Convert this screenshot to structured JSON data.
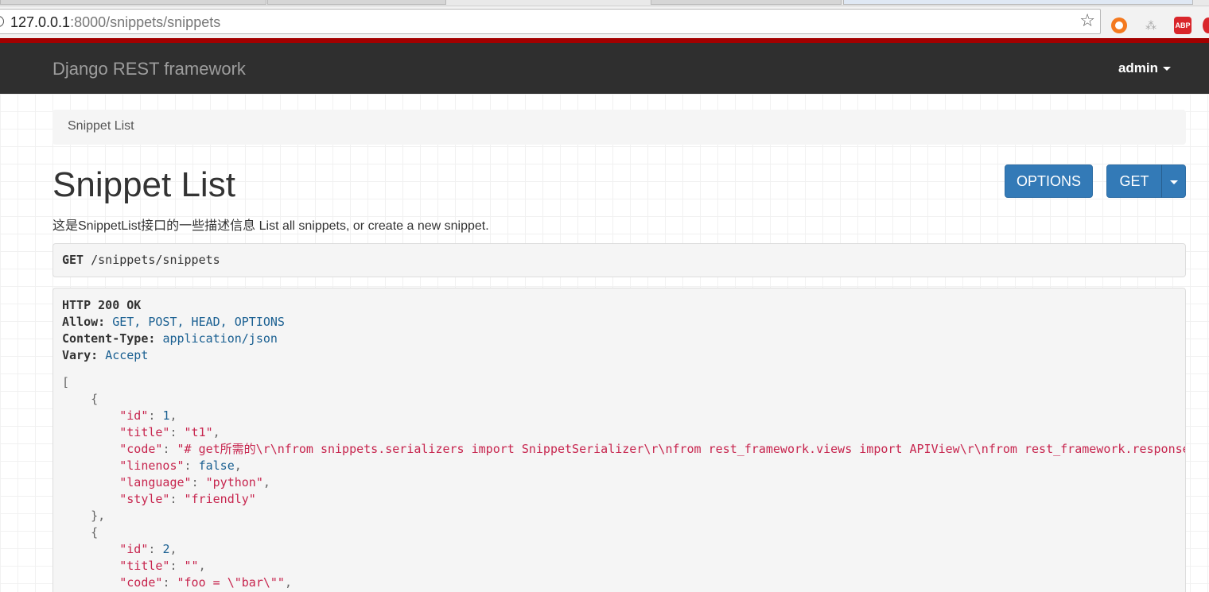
{
  "browser": {
    "url_host": "127.0.0.1",
    "url_rest": ":8000/snippets/snippets",
    "ext_abp_label": "ABP"
  },
  "navbar": {
    "brand": "Django REST framework",
    "user": "admin"
  },
  "breadcrumb": {
    "item": "Snippet List"
  },
  "page": {
    "title": "Snippet List",
    "description": "这是SnippetList接口的一些描述信息 List all snippets, or create a new snippet.",
    "options_button": "OPTIONS",
    "get_button": "GET"
  },
  "request": {
    "method": "GET",
    "path": "/snippets/snippets"
  },
  "response": {
    "status": "HTTP 200 OK",
    "headers": [
      {
        "name": "Allow:",
        "value": "GET, POST, HEAD, OPTIONS"
      },
      {
        "name": "Content-Type:",
        "value": "application/json"
      },
      {
        "name": "Vary:",
        "value": "Accept"
      }
    ],
    "open_bracket": "[",
    "items": [
      {
        "open": "{",
        "fields": [
          {
            "key": "\"id\"",
            "sep": ": ",
            "value": "1",
            "type": "lit",
            "comma": ","
          },
          {
            "key": "\"title\"",
            "sep": ": ",
            "value": "\"t1\"",
            "type": "str",
            "comma": ","
          },
          {
            "key": "\"code\"",
            "sep": ": ",
            "value": "\"# get所需的\\r\\nfrom snippets.serializers import SnippetSerializer\\r\\nfrom rest_framework.views import APIView\\r\\nfrom rest_framework.response import Response",
            "type": "str",
            "comma": ""
          },
          {
            "key": "\"linenos\"",
            "sep": ": ",
            "value": "false",
            "type": "lit",
            "comma": ","
          },
          {
            "key": "\"language\"",
            "sep": ": ",
            "value": "\"python\"",
            "type": "str",
            "comma": ","
          },
          {
            "key": "\"style\"",
            "sep": ": ",
            "value": "\"friendly\"",
            "type": "str",
            "comma": ""
          }
        ],
        "close": "},"
      },
      {
        "open": "{",
        "fields": [
          {
            "key": "\"id\"",
            "sep": ": ",
            "value": "2",
            "type": "lit",
            "comma": ","
          },
          {
            "key": "\"title\"",
            "sep": ": ",
            "value": "\"\"",
            "type": "str",
            "comma": ","
          },
          {
            "key": "\"code\"",
            "sep": ": ",
            "value": "\"foo = \\\"bar\\\"\"",
            "type": "str",
            "comma": ","
          }
        ],
        "close": ""
      }
    ]
  },
  "colors": {
    "navbar_bg": "#2f2f2f",
    "accent_red": "#a30000",
    "button_blue": "#337ab7",
    "json_string": "#c7254e",
    "json_literal": "#195f91"
  }
}
